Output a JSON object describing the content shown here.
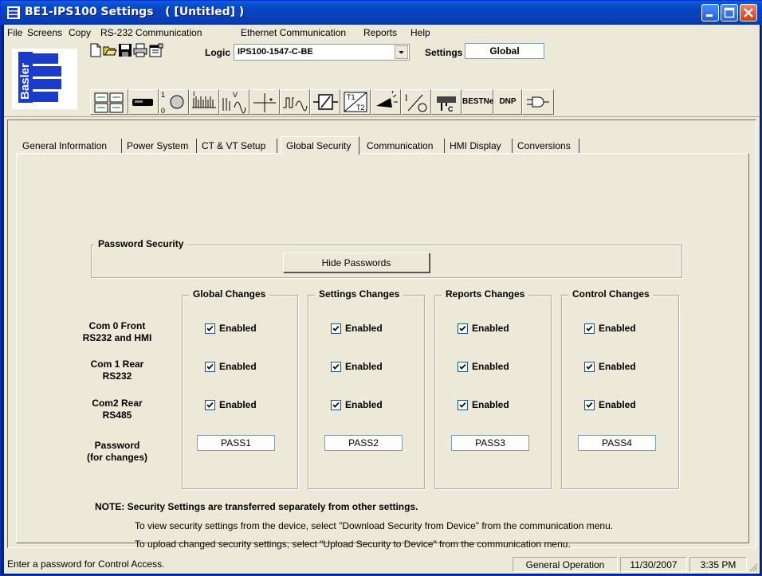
{
  "window": {
    "title": "BE1-IPS100 Settings   ( [Untitled] )",
    "controls": {
      "minimize": "minimize-icon",
      "maximize": "maximize-icon",
      "close": "close-icon"
    }
  },
  "menu": [
    "File",
    "Screens",
    "Copy",
    "RS-232 Communication",
    "Ethernet Communication",
    "Reports",
    "Help"
  ],
  "toolbar": {
    "logo_text": "Basler",
    "logic_label": "Logic",
    "logic_value": "IPS100-1547-C-BE",
    "settings_label": "Settings",
    "settings_value": "Global",
    "file_icons": [
      "new-file-icon",
      "open-folder-icon",
      "save-disk-icon",
      "print-icon",
      "properties-icon"
    ],
    "screen_buttons": {
      "bestnet": "BESTNet",
      "dnp": "DNP"
    }
  },
  "tabs": [
    "General Information",
    "Power System",
    "CT & VT Setup",
    "Global Security",
    "Communication",
    "HMI Display",
    "Conversions"
  ],
  "active_tab": "Global Security",
  "password_security": {
    "title": "Password Security",
    "hide_button": "Hide Passwords"
  },
  "rows": {
    "com0": [
      "Com 0 Front",
      "RS232 and HMI"
    ],
    "com1": [
      "Com 1 Rear",
      "RS232"
    ],
    "com2": [
      "Com2 Rear",
      "RS485"
    ],
    "password": [
      "Password",
      "(for changes)"
    ]
  },
  "groups": [
    {
      "title": "Global Changes",
      "checkbox_label": "Enabled",
      "com0": true,
      "com1": true,
      "com2": true,
      "password": "PASS1"
    },
    {
      "title": "Settings Changes",
      "checkbox_label": "Enabled",
      "com0": true,
      "com1": true,
      "com2": true,
      "password": "PASS2"
    },
    {
      "title": "Reports Changes",
      "checkbox_label": "Enabled",
      "com0": true,
      "com1": true,
      "com2": true,
      "password": "PASS3"
    },
    {
      "title": "Control Changes",
      "checkbox_label": "Enabled",
      "com0": true,
      "com1": true,
      "com2": true,
      "password": "PASS4"
    }
  ],
  "notes": {
    "heading": "NOTE: Security Settings are transferred separately from other settings.",
    "line1": "To view security settings from the device, select \"Download Security from Device\" from the communication menu.",
    "line2": "To upload changed security settings, select \"Upload Security to Device\" from the communication menu."
  },
  "status": {
    "message": "Enter a password for Control Access.",
    "mode": "General Operation",
    "date": "11/30/2007",
    "time": "3:35 PM"
  },
  "colors": {
    "titlebar": "#0846c4",
    "face": "#ece9d8",
    "logo_blue": "#1a3cc8"
  }
}
